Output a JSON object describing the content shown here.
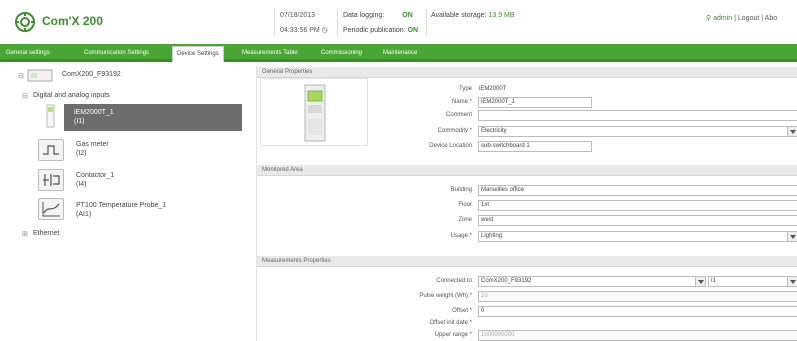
{
  "app": {
    "title": "Com'X 200"
  },
  "status": {
    "date": "07/18/2013",
    "time": "04:33:56 PM",
    "data_logging_label": "Data logging:",
    "data_logging_value": "ON",
    "periodic_label": "Periodic publication:",
    "periodic_value": "ON",
    "storage_label": "Available storage:",
    "storage_value": "13.9 MB"
  },
  "user": {
    "name": "admin",
    "logout": "Logout",
    "about": "Abo"
  },
  "tabs": [
    {
      "label": "General settings"
    },
    {
      "label": "Communication Settings"
    },
    {
      "label": "Device Settings"
    },
    {
      "label": "Measurements Table"
    },
    {
      "label": "Commissioning"
    },
    {
      "label": "Maintenance"
    }
  ],
  "tree": {
    "root": "ComX200_F93192",
    "group_digital": "Digital and analog inputs",
    "devices": [
      {
        "name": "iEM2000T_1",
        "sub": "(I1)"
      },
      {
        "name": "Gas meter",
        "sub": "(I2)"
      },
      {
        "name": "Contactor_1",
        "sub": "(I4)"
      },
      {
        "name": "PT100 Temperature Probe_1",
        "sub": "(AI1)"
      }
    ],
    "group_ethernet": "Ethernet"
  },
  "general": {
    "title": "General Properties",
    "type_label": "Type",
    "type_value": "iEM2000T",
    "name_label": "Name *",
    "name_value": "iEM2000T_1",
    "comment_label": "Comment",
    "comment_value": "",
    "commodity_label": "Commodity *",
    "commodity_value": "Electricity",
    "location_label": "Device Location",
    "location_value": "sub-switchboard 1"
  },
  "monitored": {
    "title": "Monitored Area",
    "building_label": "Building",
    "building_value": "Marseilles office",
    "floor_label": "Floor",
    "floor_value": "1st",
    "zone_label": "Zone",
    "zone_value": "west",
    "usage_label": "Usage *",
    "usage_value": "Lighting"
  },
  "measurements": {
    "title": "Measurements Properties",
    "connected_label": "Connected to",
    "connected_value": "ComX200_F93192",
    "connected_input": "I1",
    "pulse_label": "Pulse weight (Wh) *",
    "pulse_value": "10",
    "offset_label": "Offset *",
    "offset_value": "0",
    "offset_date_label": "Offset init date *",
    "offset_date_value": "",
    "upper_label": "Upper range *",
    "upper_value": "1000000000"
  }
}
